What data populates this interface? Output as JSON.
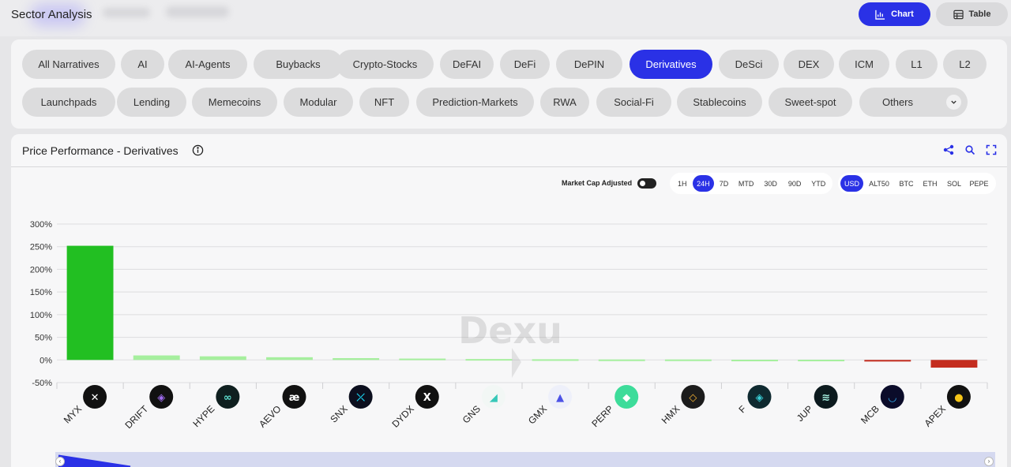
{
  "header": {
    "title": "Sector Analysis",
    "chart_button": "Chart",
    "table_button": "Table"
  },
  "narratives": {
    "row1": [
      "All Narratives",
      "AI",
      "AI-Agents",
      "Buybacks",
      "Crypto-Stocks",
      "DeFAI",
      "DeFi",
      "DePIN",
      "Derivatives",
      "DeSci",
      "DEX",
      "ICM",
      "L1",
      "L2"
    ],
    "row2": [
      "Launchpads",
      "Lending",
      "Memecoins",
      "Modular",
      "NFT",
      "Prediction-Markets",
      "RWA",
      "Social-Fi",
      "Stablecoins",
      "Sweet-spot",
      "Others"
    ],
    "active": "Derivatives"
  },
  "panel": {
    "title": "Price Performance - Derivatives",
    "market_cap_label": "Market Cap Adjusted",
    "market_cap_adjusted": false,
    "timeframes": [
      "1H",
      "24H",
      "7D",
      "MTD",
      "30D",
      "90D",
      "YTD"
    ],
    "timeframe_selected": "24H",
    "bases": [
      "USD",
      "ALT50",
      "BTC",
      "ETH",
      "SOL",
      "PEPE"
    ],
    "base_selected": "USD"
  },
  "watermark": "Dexu",
  "colors": {
    "accent": "#2a31e6",
    "positive_strong": "#22bf22",
    "positive_weak": "#a6ef9e",
    "negative": "#c42d1f"
  },
  "chart_data": {
    "type": "bar",
    "categories": [
      "MYX",
      "DRIFT",
      "HYPE",
      "AEVO",
      "SNX",
      "DYDX",
      "GNS",
      "GMX",
      "PERP",
      "HMX",
      "F",
      "JUP",
      "MCB",
      "APEX"
    ],
    "values": [
      252,
      10,
      8,
      6,
      4,
      3,
      2,
      1.5,
      1,
      1,
      0.5,
      0.5,
      -2,
      -17
    ],
    "ylim": [
      -50,
      300
    ],
    "yticks": [
      "-50%",
      "0%",
      "50%",
      "100%",
      "150%",
      "200%",
      "250%",
      "300%"
    ],
    "ytick_values": [
      -50,
      0,
      50,
      100,
      150,
      200,
      250,
      300
    ],
    "grid": true,
    "title": "",
    "xlabel": "",
    "ylabel": ""
  }
}
